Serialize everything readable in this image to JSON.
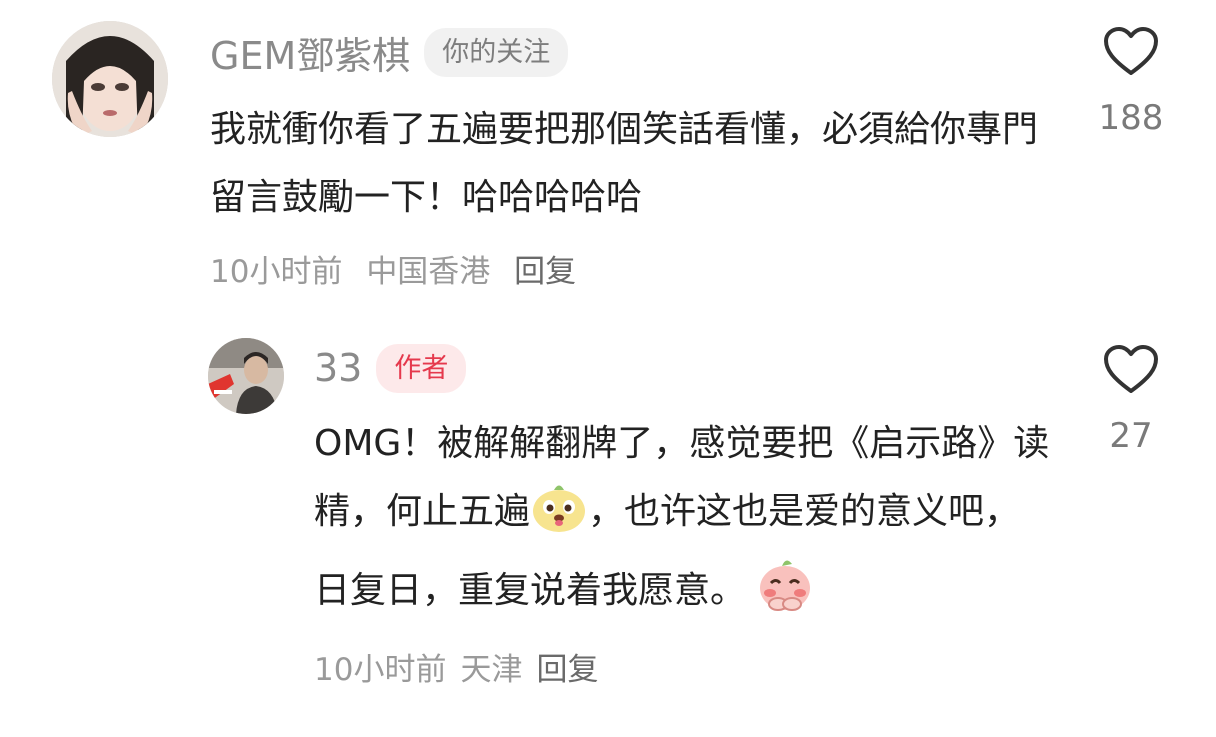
{
  "comments": [
    {
      "username": "GEM鄧紫棋",
      "badge": "你的关注",
      "text": "我就衝你看了五遍要把那個笑話看懂，必須給你專門留言鼓勵一下！哈哈哈哈哈",
      "time": "10小时前",
      "location": "中国香港",
      "reply_label": "回复",
      "likes": "188",
      "avatar_icon": "avatar-photo"
    }
  ],
  "replies": [
    {
      "username": "33",
      "badge": "作者",
      "text_part1": "OMG！被解解翻牌了，感觉要把《启示路》读精，何止五遍",
      "text_part2": "，也许这也是爱的意义吧，日复日，重复说着我愿意。",
      "emoji1": "dog-face-emoji",
      "emoji2": "shy-peach-emoji",
      "time": "10小时前",
      "location": "天津",
      "reply_label": "回复",
      "likes": "27",
      "avatar_icon": "avatar-photo"
    }
  ],
  "colors": {
    "author_badge": "#e5394d",
    "author_badge_bg": "#fde9ea",
    "muted_text": "#9a9a9a"
  }
}
